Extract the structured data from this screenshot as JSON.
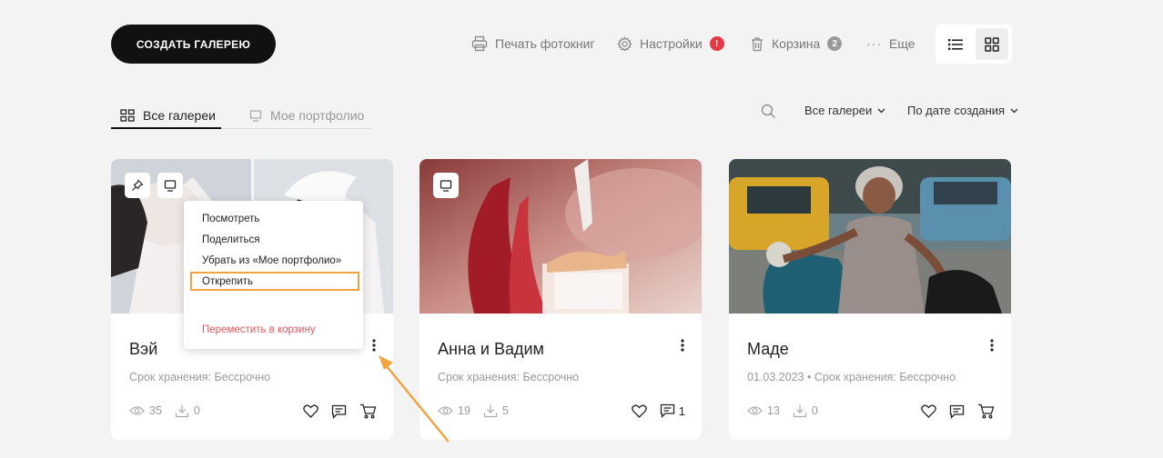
{
  "header": {
    "create_button": "СОЗДАТЬ ГАЛЕРЕЮ",
    "print_label": "Печать фотокниг",
    "settings_label": "Настройки",
    "settings_badge": "!",
    "trash_label": "Корзина",
    "trash_badge": "2",
    "more_label": "Еще"
  },
  "tabs": [
    {
      "label": "Все галереи",
      "active": true,
      "icon": "grid-icon"
    },
    {
      "label": "Мое портфолио",
      "active": false,
      "icon": "monitor-icon"
    }
  ],
  "filters": {
    "gallery_filter": "Все галереи",
    "sort": "По дате создания"
  },
  "colors": {
    "accent_red": "#e63946",
    "highlight_orange": "#f0a341",
    "danger_text": "#e8535a"
  },
  "cards": [
    {
      "title": "Вэй",
      "meta": "Срок хранения: Бессрочно",
      "views": "35",
      "downloads": "0",
      "comments": ""
    },
    {
      "title": "Анна и Вадим",
      "meta": "Срок хранения: Бессрочно",
      "views": "19",
      "downloads": "5",
      "comments": "1"
    },
    {
      "title": "Маде",
      "meta": "01.03.2023 • Срок хранения: Бессрочно",
      "views": "13",
      "downloads": "0",
      "comments": ""
    }
  ],
  "context_menu": {
    "items": [
      "Посмотреть",
      "Поделиться",
      "Убрать из «Мое портфолио»",
      "Открепить"
    ],
    "danger_item": "Переместить в корзину"
  }
}
